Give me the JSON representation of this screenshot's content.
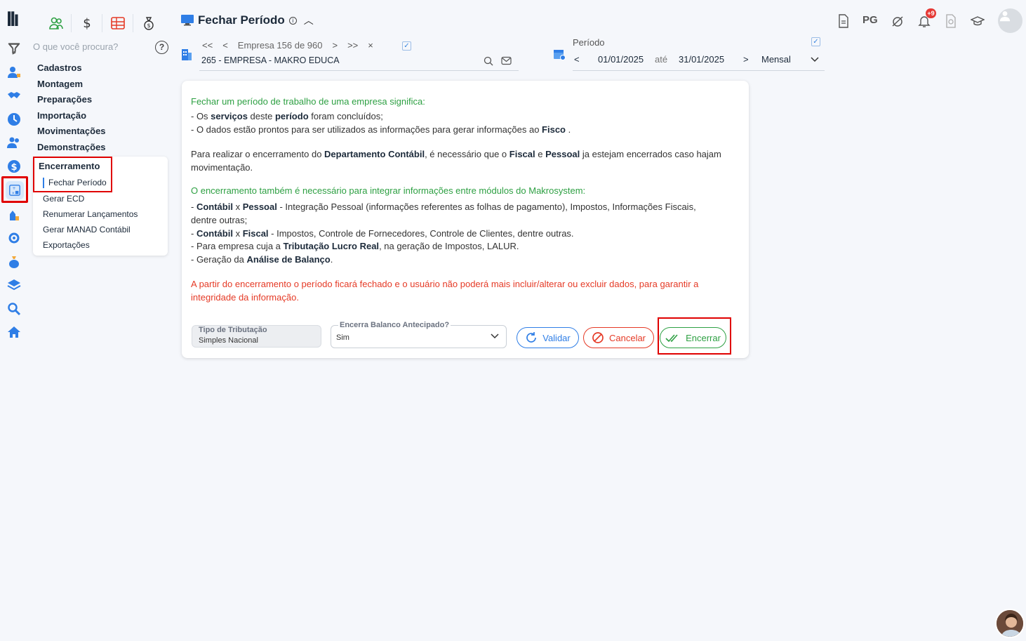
{
  "search": {
    "placeholder": "O que você procura?"
  },
  "menu": {
    "items": [
      "Cadastros",
      "Montagem",
      "Preparações",
      "Importação",
      "Movimentações",
      "Demonstrações"
    ],
    "open_section": "Encerramento",
    "active_item": "Fechar Período",
    "sub_items": [
      "Gerar ECD",
      "Renumerar Lançamentos",
      "Gerar MANAD Contábil",
      "Exportações"
    ]
  },
  "header": {
    "title": "Fechar Período"
  },
  "empresa": {
    "first": "<<",
    "prev": "<",
    "label": "Empresa 156 de 960",
    "next": ">",
    "last": ">>",
    "close": "×",
    "name": "265 - EMPRESA - MAKRO EDUCA"
  },
  "periodo": {
    "label": "Período",
    "prev": "<",
    "start": "01/01/2025",
    "until": "até",
    "end": "31/01/2025",
    "next": ">",
    "mode": "Mensal"
  },
  "topbar": {
    "pg": "PG",
    "notifications": "+9"
  },
  "card": {
    "intro_title": "Fechar um período de trabalho de uma empresa significa:",
    "l1_a": "- Os ",
    "l1_b": "serviços",
    "l1_c": " deste ",
    "l1_d": "período",
    "l1_e": " foram concluídos;",
    "l2_a": "- O dados estão prontos para ser utilizados as informações para gerar informações ao ",
    "l2_b": "Fisco",
    "l2_c": " .",
    "p2_a": "Para realizar o encerramento do ",
    "p2_b": "Departamento Contábil",
    "p2_c": ", é necessário que o ",
    "p2_d": "Fiscal",
    "p2_e": " e ",
    "p2_f": "Pessoal",
    "p2_g": " ja estejam encerrados caso hajam movimentação.",
    "integr_title": "O encerramento também é necessário para integrar informações entre módulos do Makrosystem:",
    "i1_a": "- ",
    "i1_b": "Contábil",
    "i1_c": " x ",
    "i1_d": "Pessoal",
    "i1_e": " - Integração Pessoal (informações referentes as folhas de pagamento), Impostos, Informações Fiscais, dentre outras;",
    "i2_a": "- ",
    "i2_b": "Contábil",
    "i2_c": " x ",
    "i2_d": "Fiscal",
    "i2_e": " - Impostos, Controle de Fornecedores, Controle de Clientes, dentre outras.",
    "i3_a": "- Para empresa cuja a ",
    "i3_b": "Tributação Lucro Real",
    "i3_c": ", na geração de Impostos, LALUR.",
    "i4_a": "- Geração da ",
    "i4_b": "Análise de Balanço",
    "i4_c": ".",
    "warning": "A partir do encerramento o período ficará fechado e o usuário não poderá mais incluir/alterar ou excluir dados, para garantir a integridade da informação."
  },
  "form": {
    "trib_label": "Tipo de Tributação",
    "trib_value": "Simples Nacional",
    "balanco_label": "Encerra Balanco Antecipado?",
    "balanco_value": "Sim"
  },
  "buttons": {
    "validar": "Validar",
    "cancelar": "Cancelar",
    "encerrar": "Encerrar"
  },
  "colors": {
    "accent": "#2f7ee6",
    "green": "#2ea043",
    "red": "#e53a26",
    "highlight": "#e00000"
  }
}
